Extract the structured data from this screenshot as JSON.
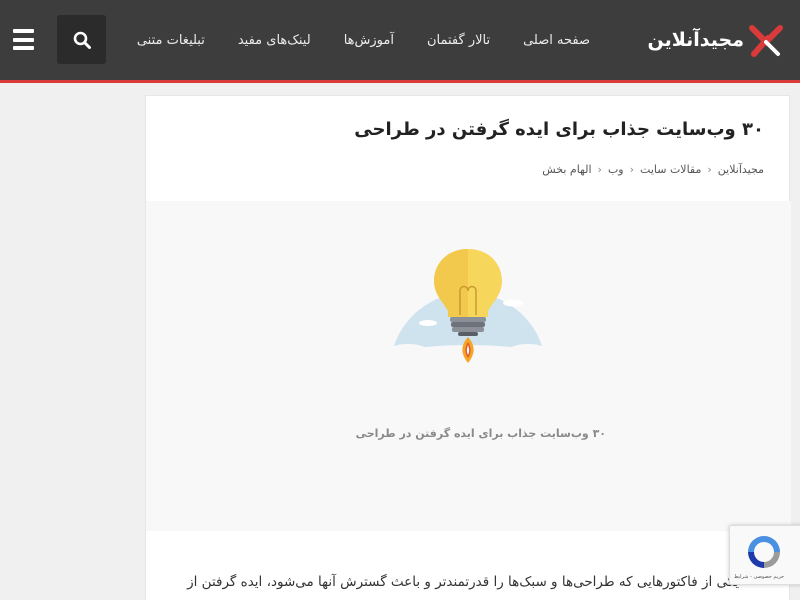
{
  "header": {
    "logo_text": "مجیدآنلاین",
    "nav": [
      {
        "label": "صفحه اصلی"
      },
      {
        "label": "تالار گفتمان"
      },
      {
        "label": "آموزش‌ها"
      },
      {
        "label": "لینک‌های مفید"
      },
      {
        "label": "تبلیغات متنی"
      }
    ],
    "icons": {
      "search": "search-icon",
      "menu": "hamburger-menu-icon"
    },
    "colors": {
      "background": "#3d3d3d",
      "accent": "#d93a3a"
    }
  },
  "article": {
    "title": "۳۰ وب‌سایت جذاب برای ایده گرفتن در طراحی",
    "breadcrumb": [
      "مجیدآنلاین",
      "مقالات سایت",
      "وب",
      "الهام بخش"
    ],
    "featured_caption": "۳۰ وب‌سایت جذاب برای ایده گرفتن در طراحی",
    "body_first_line": "یکی از فاکتورهایی که طراحی‌ها و سبک‌ها را قدرتمندتر و باعث گسترش آنها می‌شود، ایده گرفتن از"
  },
  "recaptcha": {
    "text": "حریم خصوصی - شرایط"
  }
}
